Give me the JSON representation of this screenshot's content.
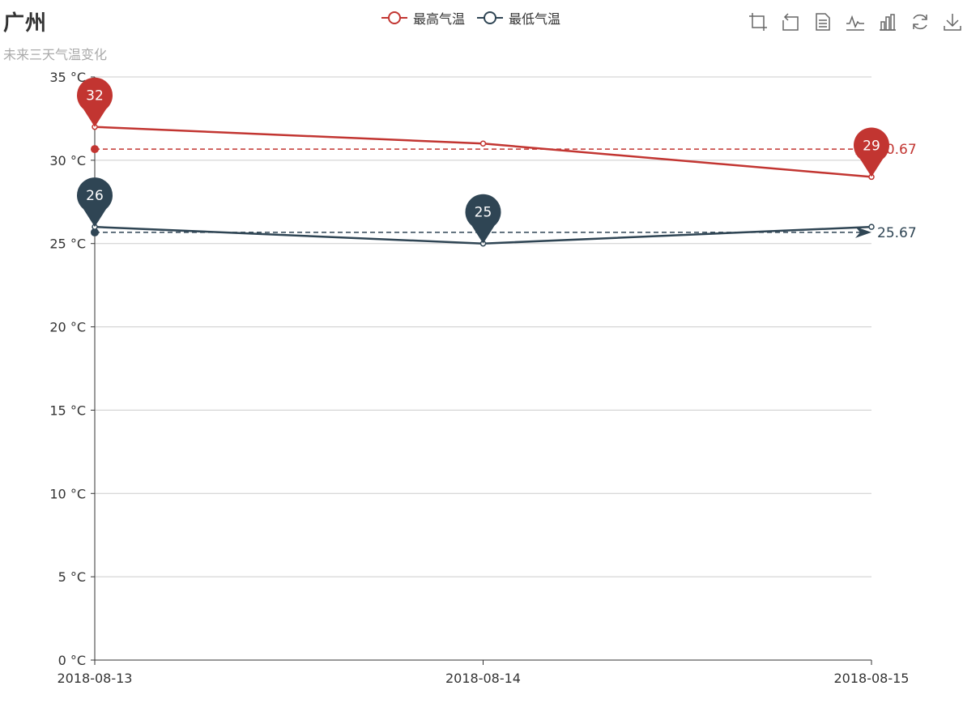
{
  "title": "广州",
  "subtitle": "未来三天气温变化",
  "legend": [
    {
      "name": "最高气温",
      "color": "#c23531"
    },
    {
      "name": "最低气温",
      "color": "#2f4554"
    }
  ],
  "toolbox": [
    "zoom-icon",
    "zoom-reset-icon",
    "data-view-icon",
    "line-chart-icon",
    "bar-chart-icon",
    "restore-icon",
    "save-image-icon"
  ],
  "chart_data": {
    "type": "line",
    "categories": [
      "2018-08-13",
      "2018-08-14",
      "2018-08-15"
    ],
    "y_axis_unit": "°C",
    "y_ticks": [
      "0 °C",
      "5 °C",
      "10 °C",
      "15 °C",
      "20 °C",
      "25 °C",
      "30 °C",
      "35 °C"
    ],
    "ylim": [
      0,
      35
    ],
    "grid": true,
    "legend_position": "top-center",
    "series": [
      {
        "name": "最高气温",
        "color": "#c23531",
        "values": [
          32,
          31,
          29
        ],
        "mark_points": [
          {
            "category": "2018-08-13",
            "value": 32,
            "label": "32"
          },
          {
            "category": "2018-08-15",
            "value": 29,
            "label": "29"
          }
        ],
        "mark_line": {
          "type": "average",
          "value": 30.67,
          "label": "30.67"
        }
      },
      {
        "name": "最低气温",
        "color": "#2f4554",
        "values": [
          26,
          25,
          26
        ],
        "mark_points": [
          {
            "category": "2018-08-13",
            "value": 26,
            "label": "26"
          },
          {
            "category": "2018-08-14",
            "value": 25,
            "label": "25"
          }
        ],
        "mark_line": {
          "type": "average",
          "value": 25.67,
          "label": "25.67"
        }
      }
    ]
  }
}
